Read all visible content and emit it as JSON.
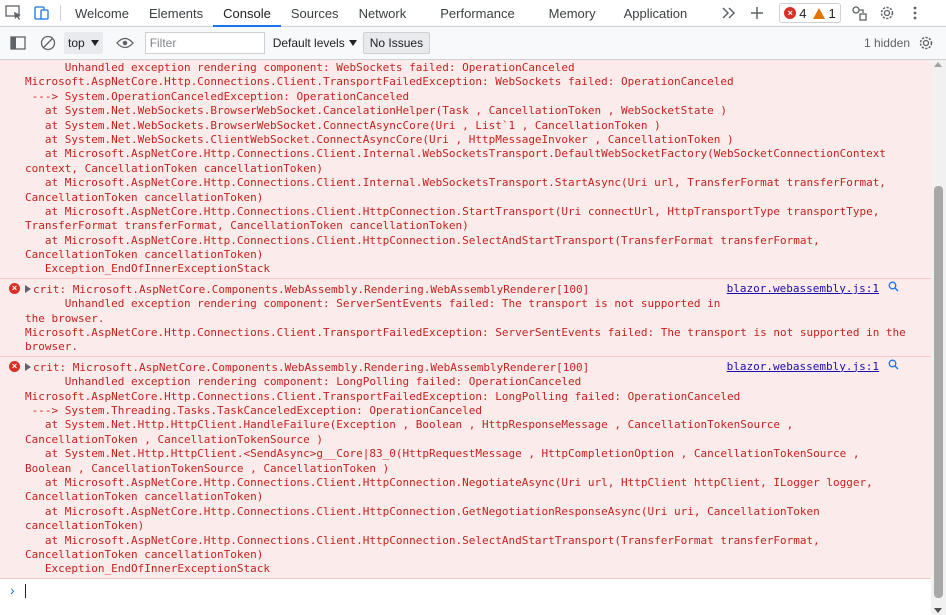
{
  "tabs": [
    {
      "label": "Welcome",
      "active": false
    },
    {
      "label": "Elements",
      "active": false
    },
    {
      "label": "Console",
      "active": true
    },
    {
      "label": "Sources",
      "active": false
    },
    {
      "label": "Network",
      "active": false
    },
    {
      "label": "Performance",
      "active": false
    },
    {
      "label": "Memory",
      "active": false
    },
    {
      "label": "Application",
      "active": false
    }
  ],
  "counts": {
    "errors": "4",
    "warnings": "1"
  },
  "toolbar": {
    "context": "top",
    "filter_placeholder": "Filter",
    "levels_label": "Default levels",
    "issues_label": "No Issues",
    "hidden_label": "1 hidden"
  },
  "messages": [
    {
      "has_icon": false,
      "source": "",
      "lines": [
        "      Unhandled exception rendering component: WebSockets failed: OperationCanceled",
        "Microsoft.AspNetCore.Http.Connections.Client.TransportFailedException: WebSockets failed: OperationCanceled",
        " ---> System.OperationCanceledException: OperationCanceled",
        "   at System.Net.WebSockets.BrowserWebSocket.CancelationHelper(Task , CancellationToken , WebSocketState )",
        "   at System.Net.WebSockets.BrowserWebSocket.ConnectAsyncCore(Uri , List`1 , CancellationToken )",
        "   at System.Net.WebSockets.ClientWebSocket.ConnectAsyncCore(Uri , HttpMessageInvoker , CancellationToken )",
        "   at Microsoft.AspNetCore.Http.Connections.Client.Internal.WebSocketsTransport.DefaultWebSocketFactory(WebSocketConnectionContext",
        "context, CancellationToken cancellationToken)",
        "   at Microsoft.AspNetCore.Http.Connections.Client.Internal.WebSocketsTransport.StartAsync(Uri url, TransferFormat transferFormat,",
        "CancellationToken cancellationToken)",
        "   at Microsoft.AspNetCore.Http.Connections.Client.HttpConnection.StartTransport(Uri connectUrl, HttpTransportType transportType,",
        "TransferFormat transferFormat, CancellationToken cancellationToken)",
        "   at Microsoft.AspNetCore.Http.Connections.Client.HttpConnection.SelectAndStartTransport(TransferFormat transferFormat,",
        "CancellationToken cancellationToken)",
        "   Exception_EndOfInnerExceptionStack"
      ]
    },
    {
      "has_icon": true,
      "source": "blazor.webassembly.js:1",
      "lines": [
        "crit: Microsoft.AspNetCore.Components.WebAssembly.Rendering.WebAssemblyRenderer[100]",
        "      Unhandled exception rendering component: ServerSentEvents failed: The transport is not supported in",
        "the browser.",
        "Microsoft.AspNetCore.Http.Connections.Client.TransportFailedException: ServerSentEvents failed: The transport is not supported in the",
        "browser."
      ]
    },
    {
      "has_icon": true,
      "source": "blazor.webassembly.js:1",
      "lines": [
        "crit: Microsoft.AspNetCore.Components.WebAssembly.Rendering.WebAssemblyRenderer[100]",
        "      Unhandled exception rendering component: LongPolling failed: OperationCanceled",
        "Microsoft.AspNetCore.Http.Connections.Client.TransportFailedException: LongPolling failed: OperationCanceled",
        " ---> System.Threading.Tasks.TaskCanceledException: OperationCanceled",
        "   at System.Net.Http.HttpClient.HandleFailure(Exception , Boolean , HttpResponseMessage , CancellationTokenSource ,",
        "CancellationToken , CancellationTokenSource )",
        "   at System.Net.Http.HttpClient.<SendAsync>g__Core|83_0(HttpRequestMessage , HttpCompletionOption , CancellationTokenSource ,",
        "Boolean , CancellationTokenSource , CancellationToken )",
        "   at Microsoft.AspNetCore.Http.Connections.Client.HttpConnection.NegotiateAsync(Uri url, HttpClient httpClient, ILogger logger,",
        "CancellationToken cancellationToken)",
        "   at Microsoft.AspNetCore.Http.Connections.Client.HttpConnection.GetNegotiationResponseAsync(Uri uri, CancellationToken",
        "cancellationToken)",
        "   at Microsoft.AspNetCore.Http.Connections.Client.HttpConnection.SelectAndStartTransport(TransferFormat transferFormat,",
        "CancellationToken cancellationToken)",
        "   Exception_EndOfInnerExceptionStack"
      ]
    }
  ]
}
